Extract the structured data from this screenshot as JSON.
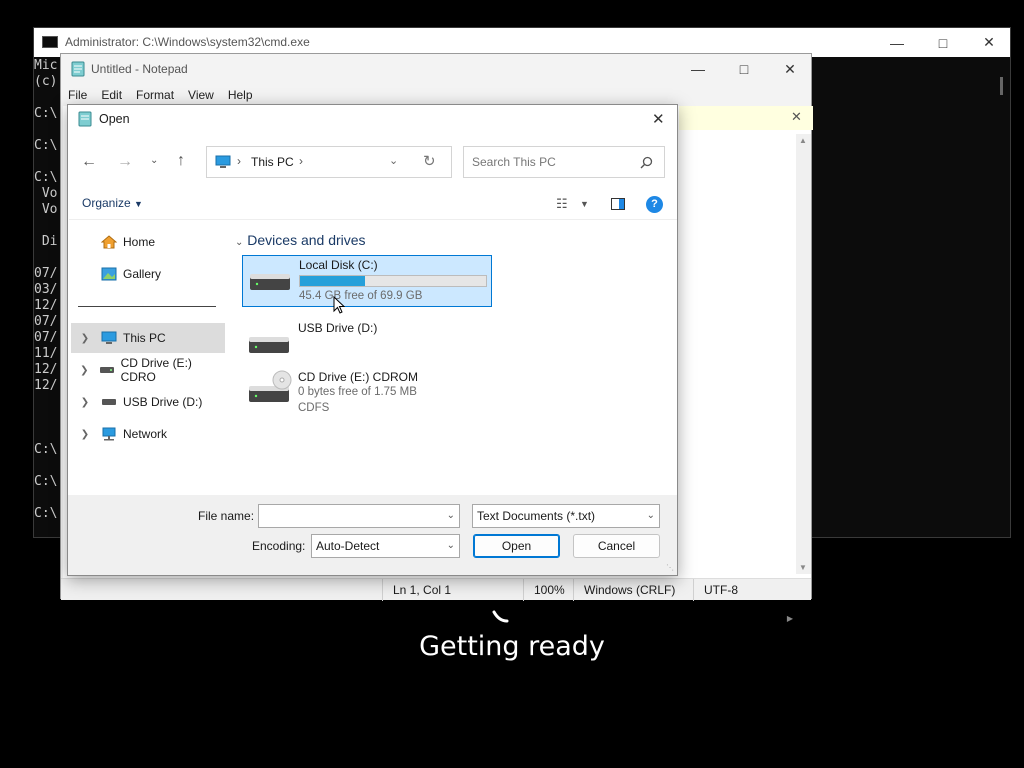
{
  "cmd": {
    "title": "Administrator: C:\\Windows\\system32\\cmd.exe",
    "lines": [
      "Mic",
      "(c)",
      "",
      "C:\\",
      "",
      "C:\\",
      "",
      "C:\\",
      " Vo",
      " Vo",
      "",
      " Di",
      "",
      "07/",
      "03/",
      "12/",
      "07/",
      "07/",
      "11/",
      "12/",
      "12/",
      "",
      "",
      "",
      "C:\\",
      "",
      "C:\\",
      "",
      "C:\\"
    ]
  },
  "notepad": {
    "title": "Untitled - Notepad",
    "menu": [
      "File",
      "Edit",
      "Format",
      "View",
      "Help"
    ],
    "status": {
      "position": "Ln 1, Col 1",
      "zoom": "100%",
      "line_ending": "Windows (CRLF)",
      "encoding": "UTF-8"
    }
  },
  "dialog": {
    "title": "Open",
    "address": {
      "segment": "This PC"
    },
    "search_placeholder": "Search This PC",
    "organize_label": "Organize",
    "nav": {
      "home": "Home",
      "gallery": "Gallery",
      "this_pc": "This PC",
      "cd_drive": "CD Drive (E:) CDRO",
      "usb_drive": "USB Drive (D:)",
      "network": "Network"
    },
    "group_label": "Devices and drives",
    "drives": [
      {
        "name": "Local Disk (C:)",
        "space": "45.4 GB free of 69.9 GB",
        "used_fraction": 0.35
      },
      {
        "name": "USB Drive (D:)"
      },
      {
        "name": "CD Drive (E:) CDROM",
        "space": "0 bytes free of 1.75 MB",
        "fs": "CDFS"
      }
    ],
    "file_name_label": "File name:",
    "file_name_value": "",
    "file_type": "Text Documents (*.txt)",
    "encoding_label": "Encoding:",
    "encoding_value": "Auto-Detect",
    "open_label": "Open",
    "cancel_label": "Cancel"
  },
  "overlay": {
    "text": "Getting ready"
  },
  "colors": {
    "selection_bg": "#cce8ff",
    "selection_border": "#0078d4",
    "accent": "#0078d4",
    "drive_bar": "#26a0da",
    "help": "#1e88e5"
  }
}
